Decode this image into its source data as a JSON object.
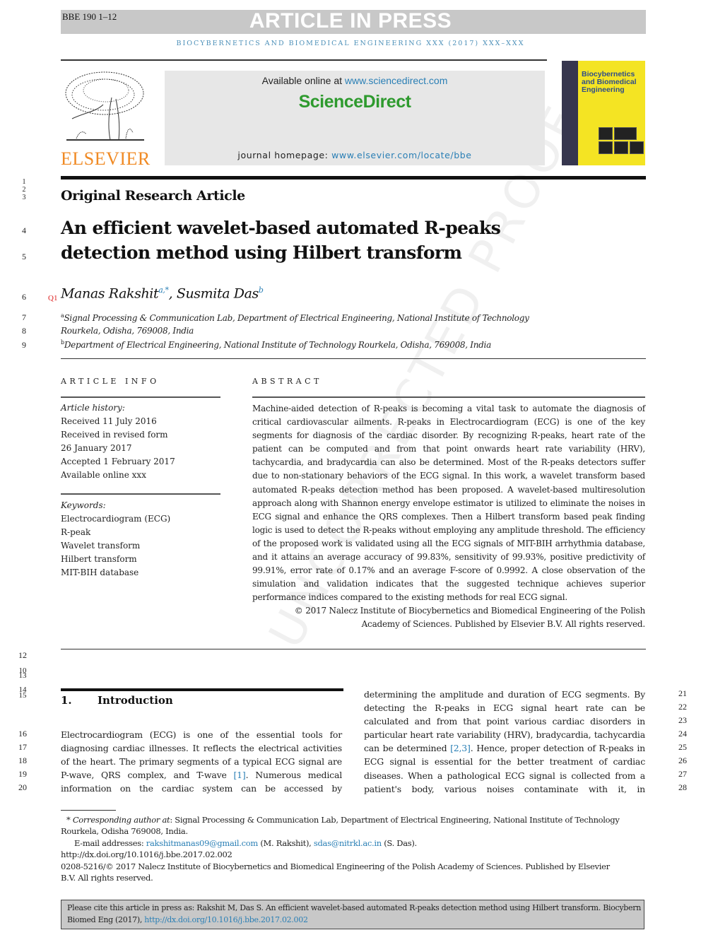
{
  "header": {
    "article_id": "BBE 190 1–12",
    "banner": "ARTICLE IN PRESS",
    "running_head": "BIOCYBERNETICS AND BIOMEDICAL ENGINEERING XXX (2017) XXX–XXX"
  },
  "masthead": {
    "publisher_logo_text": "ELSEVIER",
    "available_prefix": "Available online at ",
    "available_link": "www.sciencedirect.com",
    "platform": "ScienceDirect",
    "homepage_prefix": "journal homepage: ",
    "homepage_link": "www.elsevier.com/locate/bbe",
    "cover_title_line1": "Biocybernetics",
    "cover_title_line2": "and Biomedical",
    "cover_title_line3": "Engineering"
  },
  "article": {
    "type": "Original Research Article",
    "title_line1": "An efficient wavelet-based automated R-peaks",
    "title_line2": "detection method using Hilbert transform",
    "query_marker": "Q1",
    "author1": "Manas Rakshit",
    "author1_sup": "a,*",
    "author_sep": ", ",
    "author2": "Susmita Das",
    "author2_sup": "b",
    "affil_a_sup": "a",
    "affil_a_line1": "Signal Processing & Communication Lab, Department of Electrical Engineering, National Institute of Technology",
    "affil_a_line2": "Rourkela, Odisha, 769008, India",
    "affil_b_sup": "b",
    "affil_b": "Department of Electrical Engineering, National Institute of Technology Rourkela, Odisha, 769008, India"
  },
  "article_info": {
    "heading": "ARTICLE INFO",
    "history_label": "Article history:",
    "history": [
      "Received 11 July 2016",
      "Received in revised form",
      "26 January 2017",
      "Accepted 1 February 2017",
      "Available online xxx"
    ],
    "keywords_label": "Keywords:",
    "keywords": [
      "Electrocardiogram (ECG)",
      "R-peak",
      "Wavelet transform",
      "Hilbert transform",
      "MIT-BIH database"
    ]
  },
  "abstract": {
    "heading": "ABSTRACT",
    "text": "Machine-aided detection of R-peaks is becoming a vital task to automate the diagnosis of critical cardiovascular ailments. R-peaks in Electrocardiogram (ECG) is one of the key segments for diagnosis of the cardiac disorder. By recognizing R-peaks, heart rate of the patient can be computed and from that point onwards heart rate variability (HRV), tachycardia, and bradycardia can also be determined. Most of the R-peaks detectors suffer due to non-stationary behaviors of the ECG signal. In this work, a wavelet transform based automated R-peaks detection method has been proposed. A wavelet-based multiresolution approach along with Shannon energy envelope estimator is utilized to eliminate the noises in ECG signal and enhance the QRS complexes. Then a Hilbert transform based peak finding logic is used to detect the R-peaks without employing any amplitude threshold. The efficiency of the proposed work is validated using all the ECG signals of MIT-BIH arrhythmia database, and it attains an average accuracy of 99.83%, sensitivity of 99.93%, positive predictivity of 99.91%, error rate of 0.17% and an average F-score of 0.9992. A close observation of the simulation and validation indicates that the suggested technique achieves superior performance indices compared to the existing methods for real ECG signal.",
    "copyright_line1": "© 2017 Nalecz Institute of Biocybernetics and Biomedical Engineering of the Polish",
    "copyright_line2": "Academy of Sciences. Published by Elsevier B.V. All rights reserved."
  },
  "introduction": {
    "number": "1.",
    "title": "Introduction",
    "left_col": {
      "text_before_ref": "Electrocardiogram (ECG) is one of the essential tools for diagnosing cardiac illnesses. It reflects the electrical activities of the heart. The primary segments of a typical ECG signal are P-wave, QRS complex, and T-wave ",
      "ref": "[1]",
      "text_after_ref": ". Numerous medical information on the cardiac system can be accessed by"
    },
    "right_col": {
      "text_before_ref": "determining the amplitude and duration of ECG segments. By detecting the R-peaks in ECG signal heart rate can be calculated and from that point various cardiac disorders in particular heart rate variability (HRV), bradycardia, tachycardia can be determined ",
      "ref": "[2,3]",
      "text_after_ref": ". Hence, proper detection of R-peaks in ECG signal is essential for the better treatment of cardiac diseases. When a pathological ECG signal is collected from a patient's body, various noises contaminate with it, in"
    }
  },
  "line_numbers": {
    "top": [
      "1",
      "2",
      "3",
      "4",
      "5",
      "6",
      "7",
      "8",
      "9"
    ],
    "mid": [
      "12",
      "10",
      "13",
      "14",
      "15"
    ],
    "left": [
      "16",
      "17",
      "18",
      "19",
      "20"
    ],
    "right": [
      "21",
      "22",
      "23",
      "24",
      "25",
      "26",
      "27",
      "28"
    ]
  },
  "footnotes": {
    "corresponding_marker": "*",
    "corresponding_label": "Corresponding author at",
    "corresponding_text": ": Signal Processing & Communication Lab, Department of Electrical Engineering, National Institute of Technology",
    "corresponding_text2": "Rourkela, Odisha 769008, India.",
    "email_label": "E-mail addresses: ",
    "email1": "rakshitmanas09@gmail.com",
    "email1_name": " (M. Rakshit), ",
    "email2": "sdas@nitrkl.ac.in",
    "email2_name": " (S. Das).",
    "doi": "http://dx.doi.org/10.1016/j.bbe.2017.02.002",
    "issn_line1": "0208-5216/© 2017 Nalecz Institute of Biocybernetics and Biomedical Engineering of the Polish Academy of Sciences. Published by Elsevier",
    "issn_line2": "B.V. All rights reserved."
  },
  "citation": {
    "text": "Please cite this article in press as: Rakshit  M, Das  S. An efficient wavelet-based automated R-peaks detection method using Hilbert transform. Biocybern Biomed Eng (2017), ",
    "link": "http://dx.doi.org/10.1016/j.bbe.2017.02.002"
  },
  "watermark": "UNCORRECTED PROOF",
  "colors": {
    "link": "#2a7fb5",
    "elsevier_orange": "#f08a24",
    "sciencedirect_green": "#2e9a2e",
    "banner_gray": "#c8c8c8",
    "query_red": "#dd2222"
  }
}
